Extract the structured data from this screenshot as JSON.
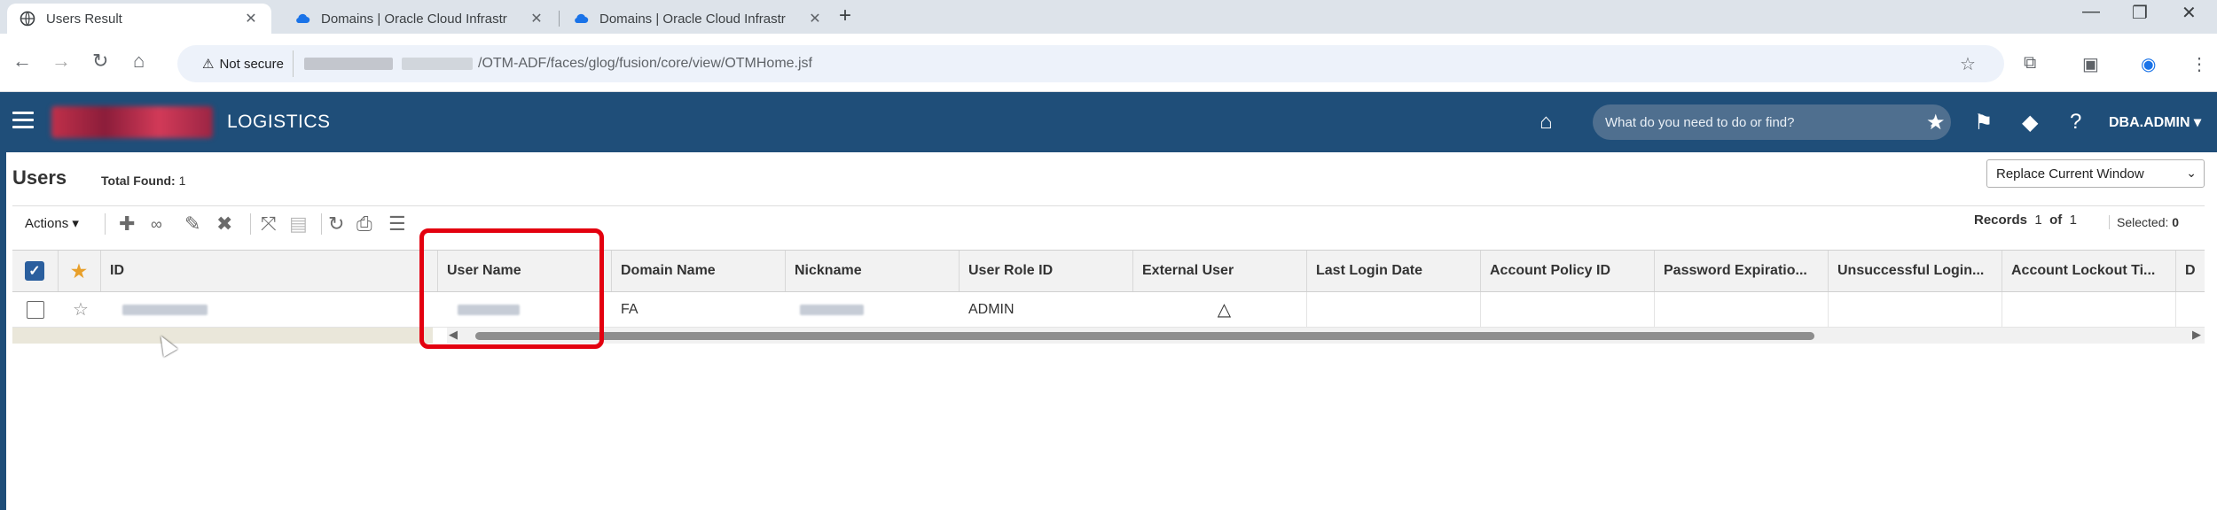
{
  "browser": {
    "tabs": [
      {
        "title": "Users Result",
        "active": true
      },
      {
        "title": "Domains | Oracle Cloud Infrastr",
        "active": false
      },
      {
        "title": "Domains | Oracle Cloud Infrastr",
        "active": false
      }
    ],
    "not_secure": "Not secure",
    "url_path": "/OTM-ADF/faces/glog/fusion/core/view/OTMHome.jsf"
  },
  "header": {
    "app_name": "LOGISTICS",
    "search_placeholder": "What do you need to do or find?",
    "user": "DBA.ADMIN"
  },
  "page": {
    "title": "Users",
    "total_label": "Total Found:",
    "total_value": "1",
    "window_select": "Replace Current Window",
    "actions_label": "Actions",
    "records_label": "Records",
    "records_from": "1",
    "records_of": "of",
    "records_to": "1",
    "selected_label": "Selected:",
    "selected_value": "0"
  },
  "table": {
    "columns": [
      "ID",
      "User Name",
      "Domain Name",
      "Nickname",
      "User Role ID",
      "External User",
      "Last Login Date",
      "Account Policy ID",
      "Password Expiratio...",
      "Unsuccessful Login...",
      "Account Lockout Ti...",
      "D"
    ],
    "rows": [
      {
        "domain": "FA",
        "role": "ADMIN"
      }
    ]
  },
  "colors": {
    "header_bg": "#1f4e79",
    "highlight": "#e3000f",
    "link": "#1f5aa6"
  }
}
